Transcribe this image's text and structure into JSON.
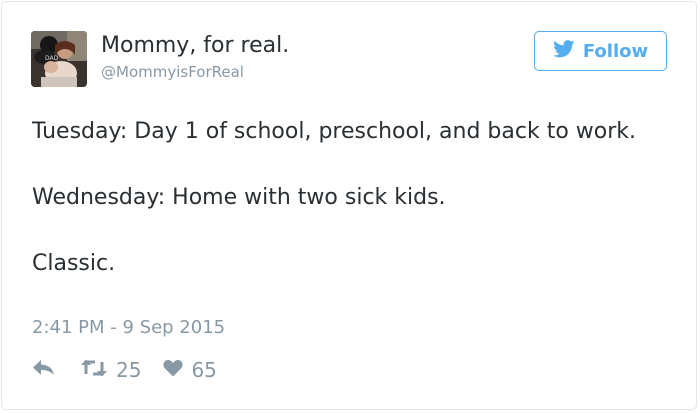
{
  "author": {
    "display_name": "Mommy, for real.",
    "handle": "@MommyisForReal"
  },
  "follow_button": {
    "label": "Follow"
  },
  "tweet": {
    "lines": [
      "Tuesday: Day 1 of school, preschool, and back to work.",
      "Wednesday: Home with two sick kids.",
      "Classic."
    ],
    "timestamp": "2:41 PM - 9 Sep 2015"
  },
  "actions": {
    "reply_icon": "reply-icon",
    "retweet_icon": "retweet-icon",
    "retweet_count": "25",
    "like_icon": "heart-icon",
    "like_count": "65"
  },
  "colors": {
    "twitter_blue": "#55acee",
    "text": "#292f33",
    "muted": "#8899a6",
    "border": "#e1e8ed"
  }
}
